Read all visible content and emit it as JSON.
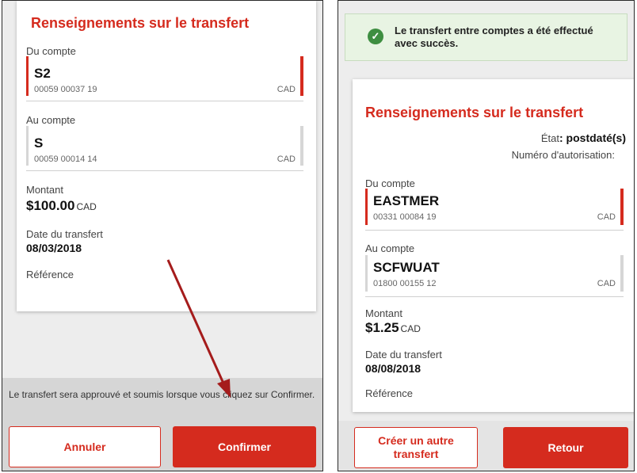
{
  "left": {
    "title": "Renseignements sur le transfert",
    "from_label": "Du compte",
    "from_account": {
      "name": "S2",
      "number": "00059 00037 19",
      "currency": "CAD"
    },
    "to_label": "Au compte",
    "to_account": {
      "name": "S",
      "number": "00059 00014 14",
      "currency": "CAD"
    },
    "amount_label": "Montant",
    "amount_value": "$100.00",
    "amount_currency": "CAD",
    "date_label": "Date du transfert",
    "date_value": "08/03/2018",
    "reference_label": "Référence",
    "footer_text": "Le transfert sera approuvé et soumis lorsque vous cliquez sur Confirmer.",
    "cancel_label": "Annuler",
    "confirm_label": "Confirmer"
  },
  "right": {
    "success_message": "Le transfert entre comptes a été effectué avec succès.",
    "title": "Renseignements sur le transfert",
    "status_label": "État",
    "status_value": ": postdaté(s)",
    "auth_label": "Numéro d'autorisation:",
    "from_label": "Du compte",
    "from_account": {
      "name": "EASTMER",
      "number": "00331 00084 19",
      "currency": "CAD"
    },
    "to_label": "Au compte",
    "to_account": {
      "name": "SCFWUAT",
      "number": "01800 00155 12",
      "currency": "CAD"
    },
    "amount_label": "Montant",
    "amount_value": "$1.25",
    "amount_currency": "CAD",
    "date_label": "Date du transfert",
    "date_value": "08/08/2018",
    "reference_label": "Référence",
    "new_transfer_label": "Créer un autre transfert",
    "back_label": "Retour"
  },
  "colors": {
    "brand_red": "#d52b1e",
    "success_green": "#3e8e41",
    "annotation_arrow": "#a51c1c"
  }
}
